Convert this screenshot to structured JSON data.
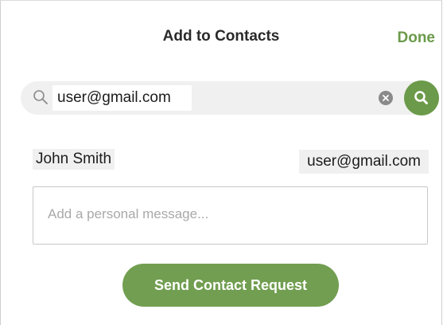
{
  "header": {
    "title": "Add to Contacts",
    "done_label": "Done"
  },
  "search": {
    "value": "user@gmail.com",
    "icon": "search-icon",
    "clear_icon": "clear-icon",
    "go_icon": "search-icon"
  },
  "result": {
    "name": "John Smith",
    "email": "user@gmail.com"
  },
  "message": {
    "placeholder": "Add a personal message..."
  },
  "actions": {
    "send_label": "Send Contact Request"
  },
  "colors": {
    "accent": "#6b9a4a",
    "field_bg": "#f0f0f0"
  }
}
